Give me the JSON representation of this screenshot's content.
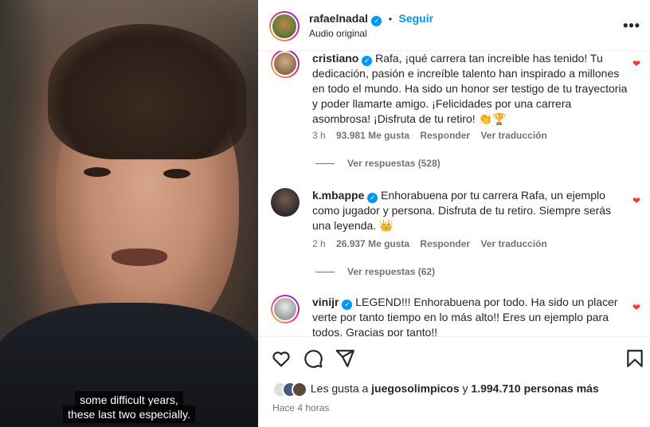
{
  "video": {
    "subtitle_line1": "some difficult years,",
    "subtitle_line2": "these last two especially."
  },
  "header": {
    "username": "rafaelnadal",
    "separator": "•",
    "follow_label": "Seguir",
    "audio_label": "Audio original",
    "more_icon": "more-horizontal-icon"
  },
  "comments": [
    {
      "username": "cristiano",
      "text": "Rafa, ¡qué carrera tan increíble has tenido! Tu dedicación, pasión e increíble talento han inspirado a millones en todo el mundo. Ha sido un honor ser testigo de tu trayectoria y poder llamarte amigo. ¡Felicidades por una carrera asombrosa! ¡Disfruta de tu retiro! 👏🏆",
      "time": "3 h",
      "likes": "93.981 Me gusta",
      "reply_label": "Responder",
      "translate_label": "Ver traducción",
      "view_replies": "Ver respuestas (528)"
    },
    {
      "username": "k.mbappe",
      "text": "Enhorabuena por tu carrera Rafa, un ejemplo como jugador y persona. Disfruta de tu retiro. Siempre serás una leyenda. 👑",
      "time": "2 h",
      "likes": "26.937 Me gusta",
      "reply_label": "Responder",
      "translate_label": "Ver traducción",
      "view_replies": "Ver respuestas (62)"
    },
    {
      "username": "vinijr",
      "text": "LEGEND!!! Enhorabuena por todo. Ha sido un placer verte por tanto tiempo en lo más alto!! Eres un ejemplo para todos. Gracias por tanto!!"
    }
  ],
  "actions": {
    "likes_prefix": "Les gusta a",
    "likes_user": "juegosolimpicos",
    "likes_and": "y",
    "likes_count": "1.994.710 personas más",
    "time_ago": "Hace 4 horas"
  },
  "colors": {
    "accent": "#0095f6",
    "heart": "#ff3040",
    "muted": "#737373"
  }
}
